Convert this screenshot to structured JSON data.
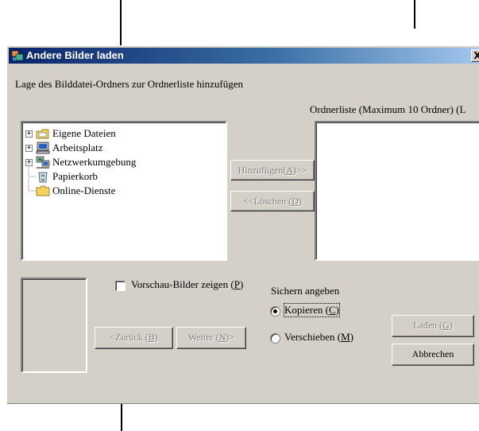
{
  "window": {
    "title": "Andere Bilder laden",
    "close_label": "X"
  },
  "instruction": "Lage des Bilddatei-Ordners zur Ordnerliste hinzufügen",
  "folder_list_label": "Ordnerliste (Maximum 10 Ordner) (L",
  "tree": [
    {
      "label": "Eigene Dateien",
      "icon": "my-documents-icon",
      "expandable": true
    },
    {
      "label": "Arbeitsplatz",
      "icon": "my-computer-icon",
      "expandable": true
    },
    {
      "label": "Netzwerkumgebung",
      "icon": "network-icon",
      "expandable": true
    },
    {
      "label": "Papierkorb",
      "icon": "recycle-bin-icon",
      "expandable": false
    },
    {
      "label": "Online-Dienste",
      "icon": "folder-icon",
      "expandable": false
    }
  ],
  "buttons": {
    "add": {
      "text": "Hinzufügen(",
      "key": "A",
      "suffix": ")>>"
    },
    "delete": {
      "text": "<<Löschen (",
      "key": "D",
      "suffix": ")"
    },
    "back": {
      "text": "<Zurück (",
      "key": "B",
      "suffix": ")"
    },
    "next": {
      "text": "Weiter (",
      "key": "N",
      "suffix": ")>"
    },
    "load": {
      "text": "Laden (",
      "key": "G",
      "suffix": ")"
    },
    "cancel": {
      "text": "Abbrechen"
    }
  },
  "preview_checkbox": {
    "text": "Vorschau-Bilder zeigen (",
    "key": "P",
    "suffix": ")",
    "checked": false
  },
  "save_group": {
    "label": "Sichern angeben",
    "copy": {
      "text": "Kopieren (",
      "key": "C",
      "suffix": ")",
      "selected": true
    },
    "move": {
      "text": "Verschieben (",
      "key": "M",
      "suffix": ")",
      "selected": false
    }
  },
  "colors": {
    "titlebar_start": "#0a246a",
    "titlebar_end": "#a6caf0",
    "face": "#d4d0c8"
  }
}
